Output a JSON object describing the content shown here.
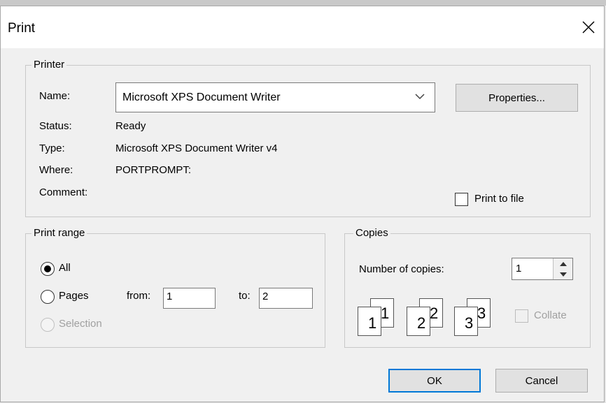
{
  "window": {
    "title": "Print",
    "close_glyph": "✕"
  },
  "printer": {
    "group_label": "Printer",
    "name_label": "Name:",
    "name_value": "Microsoft XPS Document Writer",
    "properties_button": "Properties...",
    "status_label": "Status:",
    "status_value": "Ready",
    "type_label": "Type:",
    "type_value": "Microsoft XPS Document Writer v4",
    "where_label": "Where:",
    "where_value": "PORTPROMPT:",
    "comment_label": "Comment:",
    "print_to_file_label": "Print to file",
    "print_to_file_checked": false
  },
  "print_range": {
    "group_label": "Print range",
    "all_label": "All",
    "pages_label": "Pages",
    "from_label": "from:",
    "from_value": "1",
    "to_label": "to:",
    "to_value": "2",
    "selection_label": "Selection",
    "selected": "All"
  },
  "copies": {
    "group_label": "Copies",
    "number_label": "Number of copies:",
    "number_value": "1",
    "collate_label": "Collate",
    "collate_checked": false,
    "collate_enabled": false,
    "page_pairs": [
      "1",
      "2",
      "3"
    ]
  },
  "buttons": {
    "ok": "OK",
    "cancel": "Cancel"
  },
  "colors": {
    "accent": "#0078d7",
    "dialog_bg": "#f0f0f0",
    "disabled_text": "#a0a0a0"
  }
}
